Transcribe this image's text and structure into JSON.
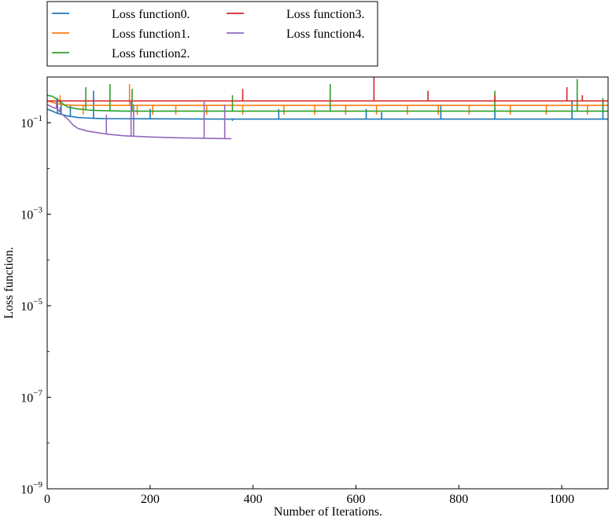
{
  "chart_data": {
    "type": "line",
    "title": "",
    "xlabel": "Number of Iterations.",
    "ylabel": "Loss function.",
    "xlim": [
      0,
      1090
    ],
    "ylim": [
      1e-09,
      1.0
    ],
    "yscale": "log",
    "x_ticks": [
      0,
      200,
      400,
      600,
      800,
      1000
    ],
    "y_ticks": [
      {
        "value": 1e-09,
        "base": "10",
        "exp": "−9"
      },
      {
        "value": 1e-07,
        "base": "10",
        "exp": "−7"
      },
      {
        "value": 1e-05,
        "base": "10",
        "exp": "−5"
      },
      {
        "value": 0.001,
        "base": "10",
        "exp": "−3"
      },
      {
        "value": 0.1,
        "base": "10",
        "exp": "−1"
      }
    ],
    "grid": false,
    "legend": {
      "placement": "above",
      "columns": 2
    },
    "series": [
      {
        "name": "Loss function0.",
        "color": "#1f77b4",
        "x": [
          0,
          10,
          20,
          30,
          40,
          50,
          60,
          75,
          90,
          120,
          200,
          300,
          360,
          450,
          600,
          800,
          1000,
          1090
        ],
        "y": [
          0.2,
          0.18,
          0.16,
          0.15,
          0.14,
          0.135,
          0.13,
          0.128,
          0.125,
          0.123,
          0.122,
          0.121,
          0.12,
          0.12,
          0.12,
          0.12,
          0.12,
          0.12
        ],
        "spikes": [
          [
            20,
            0.35
          ],
          [
            27,
            0.3
          ],
          [
            45,
            0.25
          ],
          [
            90,
            0.5
          ],
          [
            200,
            0.2
          ],
          [
            360,
            0.11
          ],
          [
            450,
            0.2
          ],
          [
            620,
            0.2
          ],
          [
            650,
            0.17
          ],
          [
            765,
            0.25
          ],
          [
            870,
            0.2
          ],
          [
            1020,
            0.3
          ],
          [
            1080,
            0.3
          ]
        ]
      },
      {
        "name": "Loss function1.",
        "color": "#ff7f0e",
        "x": [
          0,
          10,
          20,
          30,
          40,
          50,
          100,
          200,
          400,
          600,
          800,
          1000,
          1090
        ],
        "y": [
          0.3,
          0.28,
          0.26,
          0.25,
          0.245,
          0.24,
          0.24,
          0.24,
          0.24,
          0.24,
          0.24,
          0.24,
          0.24
        ],
        "spikes": [
          [
            25,
            0.4
          ],
          [
            70,
            0.15
          ],
          [
            160,
            0.7
          ],
          [
            175,
            0.15
          ],
          [
            205,
            0.15
          ],
          [
            250,
            0.15
          ],
          [
            310,
            0.15
          ],
          [
            380,
            0.15
          ],
          [
            460,
            0.15
          ],
          [
            520,
            0.15
          ],
          [
            580,
            0.15
          ],
          [
            640,
            0.15
          ],
          [
            700,
            0.15
          ],
          [
            760,
            0.15
          ],
          [
            820,
            0.15
          ],
          [
            900,
            0.15
          ],
          [
            970,
            0.15
          ],
          [
            1050,
            0.15
          ]
        ]
      },
      {
        "name": "Loss function2.",
        "color": "#2ca02c",
        "x": [
          0,
          10,
          20,
          30,
          40,
          60,
          80,
          100,
          150,
          200,
          400,
          600,
          800,
          1000,
          1090
        ],
        "y": [
          0.4,
          0.38,
          0.32,
          0.26,
          0.22,
          0.2,
          0.19,
          0.185,
          0.18,
          0.18,
          0.18,
          0.18,
          0.18,
          0.18,
          0.18
        ],
        "spikes": [
          [
            75,
            0.6
          ],
          [
            122,
            0.7
          ],
          [
            165,
            0.55
          ],
          [
            360,
            0.4
          ],
          [
            550,
            0.7
          ],
          [
            870,
            0.5
          ],
          [
            1030,
            0.9
          ],
          [
            1080,
            0.35
          ]
        ]
      },
      {
        "name": "Loss function3.",
        "color": "#d62728",
        "x": [
          0,
          20,
          40,
          100,
          200,
          400,
          600,
          800,
          1000,
          1090
        ],
        "y": [
          0.3,
          0.3,
          0.3,
          0.3,
          0.3,
          0.3,
          0.3,
          0.3,
          0.3,
          0.3
        ],
        "spikes": [
          [
            380,
            0.55
          ],
          [
            635,
            1.0
          ],
          [
            740,
            0.5
          ],
          [
            870,
            0.4
          ],
          [
            1010,
            0.6
          ],
          [
            1040,
            0.4
          ]
        ]
      },
      {
        "name": "Loss function4.",
        "color": "#9467bd",
        "x": [
          0,
          10,
          20,
          30,
          40,
          50,
          60,
          70,
          80,
          100,
          120,
          150,
          200,
          250,
          300,
          350,
          358
        ],
        "y": [
          0.25,
          0.22,
          0.2,
          0.15,
          0.12,
          0.09,
          0.075,
          0.07,
          0.065,
          0.06,
          0.056,
          0.052,
          0.049,
          0.047,
          0.046,
          0.045,
          0.045
        ],
        "spikes": [
          [
            18,
            0.3
          ],
          [
            25,
            0.22
          ],
          [
            30,
            0.15
          ],
          [
            40,
            0.12
          ],
          [
            115,
            0.15
          ],
          [
            163,
            0.3
          ],
          [
            168,
            0.25
          ],
          [
            305,
            0.3
          ],
          [
            345,
            0.25
          ]
        ]
      }
    ]
  }
}
